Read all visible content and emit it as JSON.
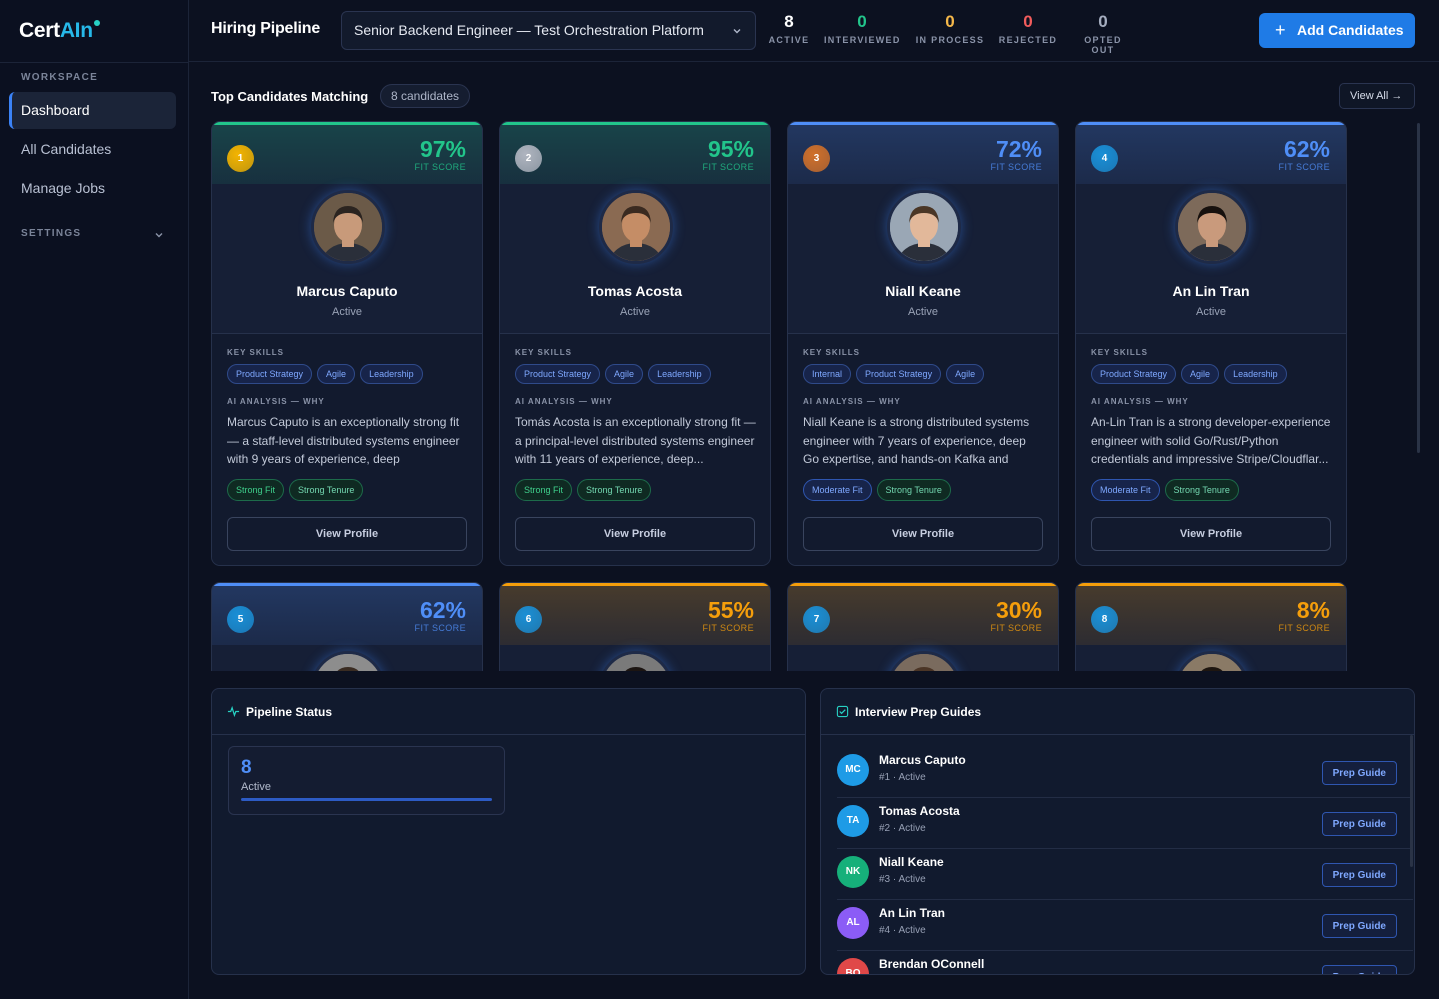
{
  "app": {
    "name_prefix": "Cert",
    "name_suffix": "AIn"
  },
  "sidebar": {
    "workspace_label": "WORKSPACE",
    "items": [
      {
        "label": "Dashboard",
        "active": true
      },
      {
        "label": "All Candidates",
        "active": false
      },
      {
        "label": "Manage Jobs",
        "active": false
      }
    ],
    "settings_label": "SETTINGS"
  },
  "topbar": {
    "title": "Hiring Pipeline",
    "job": "Senior Backend Engineer — Test Orchestration Platform",
    "stats": [
      {
        "value": "8",
        "label": "ACTIVE",
        "color": "#ffffff"
      },
      {
        "value": "0",
        "label": "INTERVIEWED",
        "color": "#22c58b"
      },
      {
        "value": "0",
        "label": "IN PROCESS",
        "color": "#f5b84a"
      },
      {
        "value": "0",
        "label": "REJECTED",
        "color": "#f25c5c"
      },
      {
        "value": "0",
        "label": "OPTED OUT",
        "color": "#a5adbf"
      }
    ],
    "add_button": "Add Candidates"
  },
  "candidates_section": {
    "title": "Top Candidates Matching",
    "count": "8 candidates",
    "view_all": "View All"
  },
  "labels": {
    "fit_score": "FIT SCORE",
    "key_skills": "KEY SKILLS",
    "ai_analysis": "AI ANALYSIS — WHY",
    "view_profile": "View Profile"
  },
  "candidates": [
    {
      "rank": "1",
      "fit": "97%",
      "name": "Marcus Caputo",
      "status": "Active",
      "accent": "#22c58b",
      "rank_color": "#f4b400",
      "skills": [
        "Product Strategy",
        "Agile",
        "Leadership"
      ],
      "why": "Marcus Caputo is an exceptionally strong fit — a staff-level distributed systems engineer with 9 years of experience, deep Go/Python...",
      "tags": [
        "Strong Fit",
        "Strong Tenure"
      ],
      "fit_kind": "strong"
    },
    {
      "rank": "2",
      "fit": "95%",
      "name": "Tomas Acosta",
      "status": "Active",
      "accent": "#22c58b",
      "rank_color": "#b0b5c0",
      "skills": [
        "Product Strategy",
        "Agile",
        "Leadership"
      ],
      "why": "Tomás Acosta is an exceptionally strong fit — a principal-level distributed systems engineer with 11 years of experience, deep...",
      "tags": [
        "Strong Fit",
        "Strong Tenure"
      ],
      "fit_kind": "strong"
    },
    {
      "rank": "3",
      "fit": "72%",
      "name": "Niall Keane",
      "status": "Active",
      "accent": "#4f8ef7",
      "rank_color": "#d0702a",
      "skills": [
        "Internal",
        "Product Strategy",
        "Agile"
      ],
      "why": "Niall Keane is a strong distributed systems engineer with 7 years of experience, deep Go expertise, and hands-on Kafka and high-...",
      "tags": [
        "Moderate Fit",
        "Strong Tenure"
      ],
      "fit_kind": "moderate"
    },
    {
      "rank": "4",
      "fit": "62%",
      "name": "An Lin Tran",
      "status": "Active",
      "accent": "#4f8ef7",
      "rank_color": "#1a8fd6",
      "skills": [
        "Product Strategy",
        "Agile",
        "Leadership"
      ],
      "why": "An-Lin Tran is a strong developer-experience engineer with solid Go/Rust/Python credentials and impressive Stripe/Cloudflar...",
      "tags": [
        "Moderate Fit",
        "Strong Tenure"
      ],
      "fit_kind": "moderate"
    },
    {
      "rank": "5",
      "fit": "62%",
      "accent": "#4f8ef7",
      "rank_color": "#1a8fd6"
    },
    {
      "rank": "6",
      "fit": "55%",
      "accent": "#f59e0b",
      "rank_color": "#1a8fd6"
    },
    {
      "rank": "7",
      "fit": "30%",
      "accent": "#f59e0b",
      "rank_color": "#1a8fd6"
    },
    {
      "rank": "8",
      "fit": "8%",
      "accent": "#f59e0b",
      "rank_color": "#1a8fd6"
    }
  ],
  "pipeline": {
    "title": "Pipeline Status",
    "value": "8",
    "label": "Active"
  },
  "prep": {
    "title": "Interview Prep Guides",
    "button": "Prep Guide",
    "rows": [
      {
        "initials": "MC",
        "name": "Marcus Caputo",
        "sub": "#1 · Active",
        "color": "#1e9be6"
      },
      {
        "initials": "TA",
        "name": "Tomas Acosta",
        "sub": "#2 · Active",
        "color": "#1e9be6"
      },
      {
        "initials": "NK",
        "name": "Niall Keane",
        "sub": "#3 · Active",
        "color": "#16b07a"
      },
      {
        "initials": "AL",
        "name": "An Lin Tran",
        "sub": "#4 · Active",
        "color": "#8b5cf6"
      },
      {
        "initials": "BO",
        "name": "Brendan OConnell",
        "sub": "",
        "color": "#e04848"
      }
    ]
  }
}
